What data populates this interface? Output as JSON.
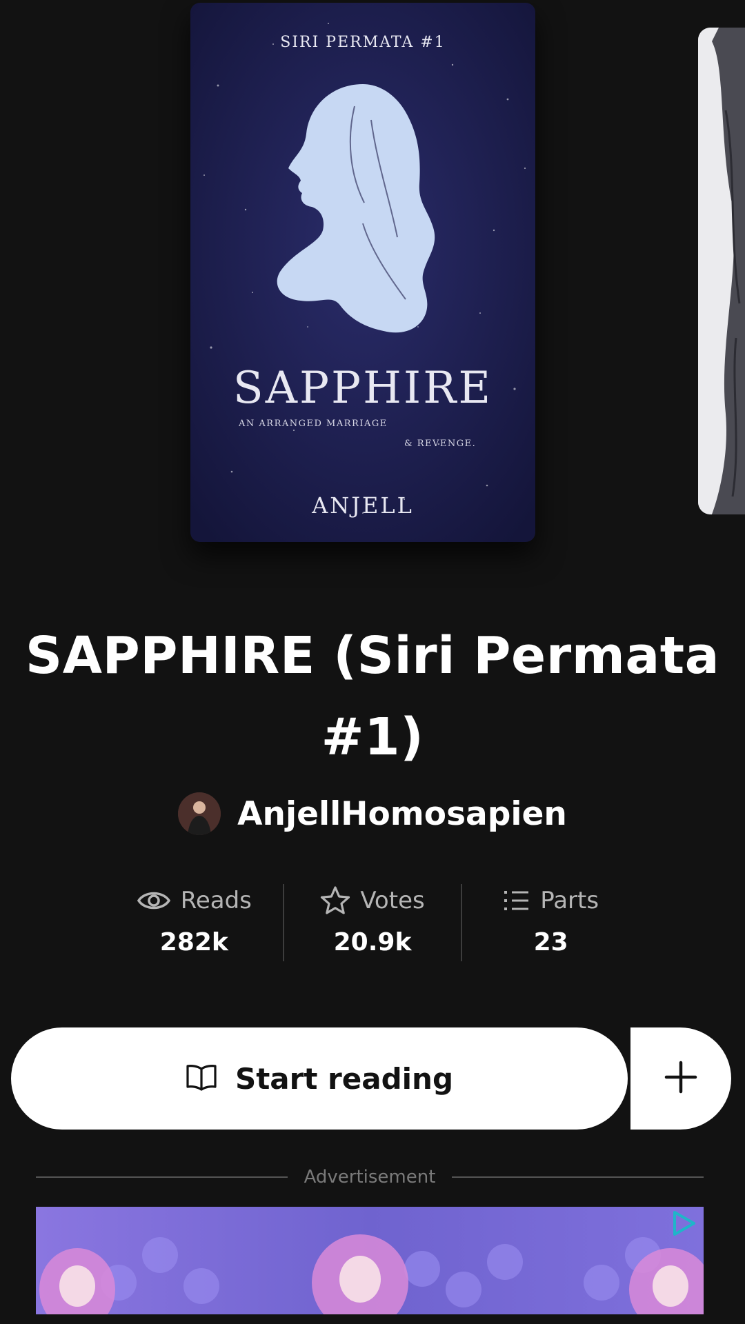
{
  "cover": {
    "series": "SIRI PERMATA #1",
    "title": "SAPPHIRE",
    "tagline_line1": "AN ARRANGED MARRIAGE",
    "tagline_line2": "& REVENGE.",
    "author": "ANJELL"
  },
  "book": {
    "title": "SAPPHIRE (Siri Permata #1)",
    "author": "AnjellHomosapien"
  },
  "stats": [
    {
      "label": "Reads",
      "value": "282k",
      "icon": "eye-icon"
    },
    {
      "label": "Votes",
      "value": "20.9k",
      "icon": "star-icon"
    },
    {
      "label": "Parts",
      "value": "23",
      "icon": "list-icon"
    }
  ],
  "actions": {
    "start_label": "Start reading",
    "start_icon": "open-book-icon",
    "add_icon": "plus-icon"
  },
  "ad": {
    "label": "Advertisement"
  },
  "colors": {
    "background": "#121212",
    "button": "#ffffff",
    "cover_navy": "#1c1d4a",
    "silhouette": "#c7d8f3",
    "ad_tint": "#7b68d8",
    "ad_pink": "#d98ad8"
  }
}
